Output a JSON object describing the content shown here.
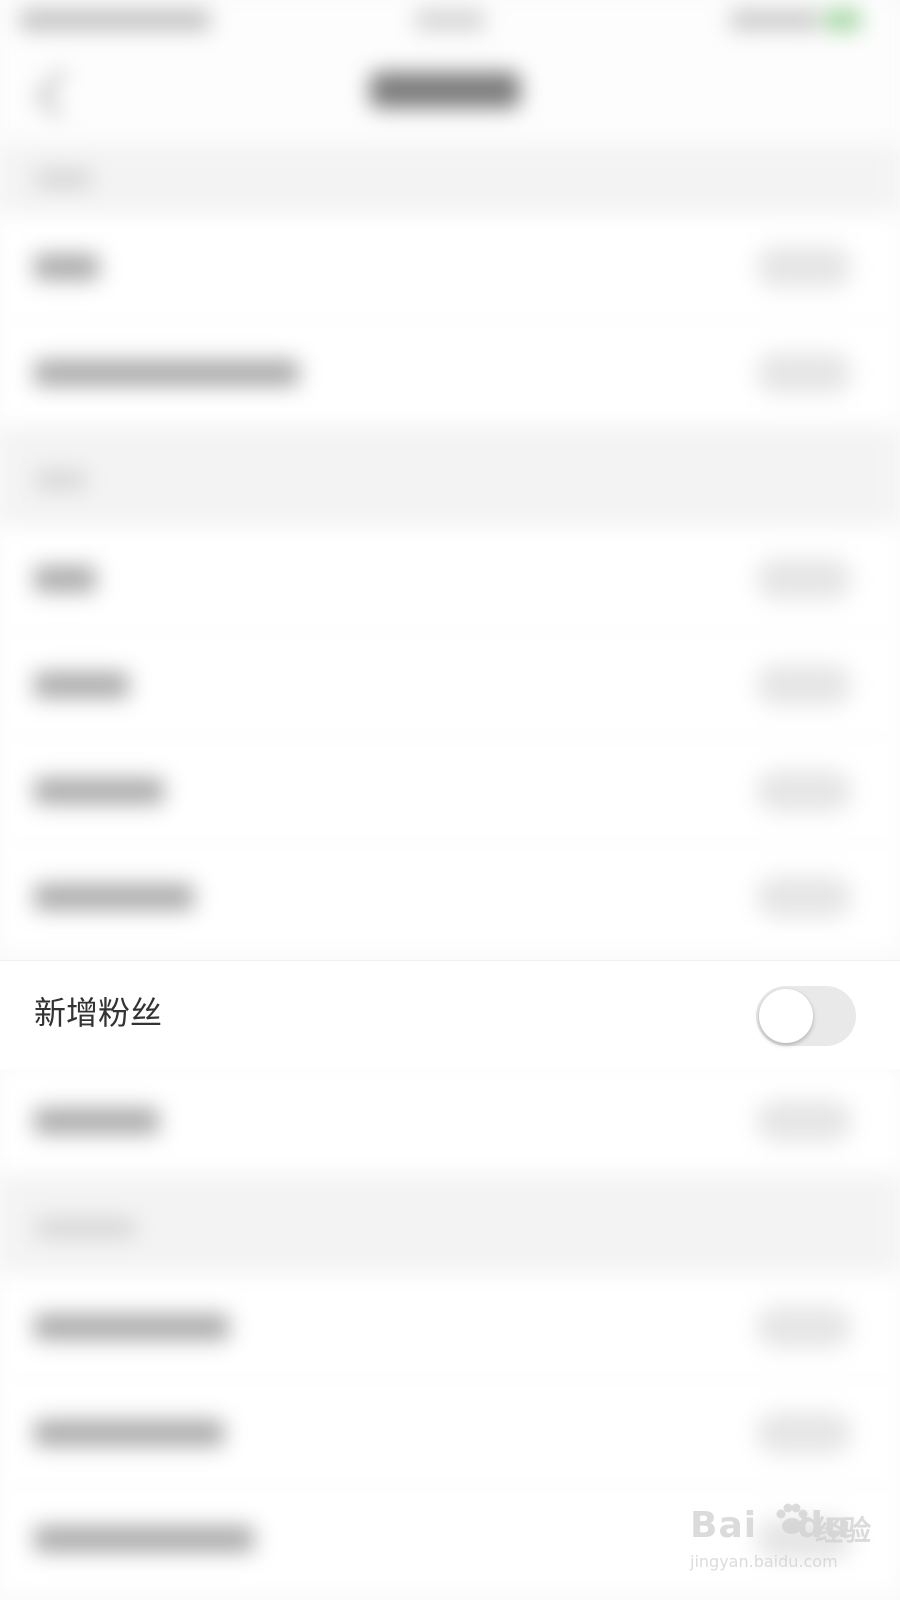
{
  "setting_row": {
    "label": "新增粉丝",
    "toggle_on": false
  },
  "watermark": {
    "brand": "Bai",
    "brand_tail": "du",
    "product": "经验",
    "url": "jingyan.baidu.com"
  },
  "colors": {
    "background": "#ffffff",
    "section_bg": "#f3f3f3",
    "toggle_off": "#e9e9e9",
    "text": "#333333"
  },
  "icons": {
    "back": "chevron-left-icon",
    "watermark": "paw-icon"
  }
}
